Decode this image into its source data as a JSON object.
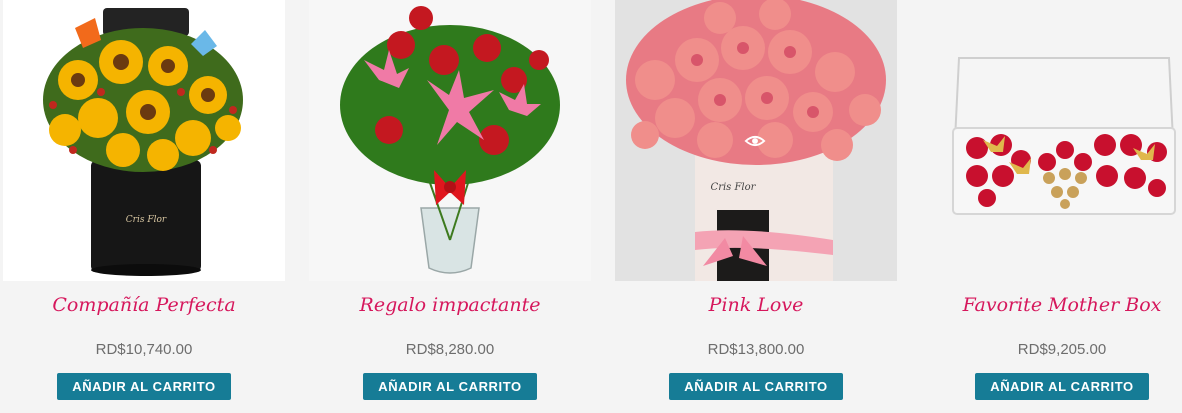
{
  "products": [
    {
      "image_alt": "sunflowers-yellow-roses-black-box",
      "title": "Compañía Perfecta",
      "price": "RD$10,740.00",
      "button_label": "AÑADIR AL CARRITO"
    },
    {
      "image_alt": "red-roses-pink-lilies-glass-vase",
      "title": "Regalo impactante",
      "price": "RD$8,280.00",
      "button_label": "AÑADIR AL CARRITO"
    },
    {
      "image_alt": "pink-roses-white-box-ribbon",
      "title": "Pink Love",
      "price": "RD$13,800.00",
      "button_label": "AÑADIR AL CARRITO"
    },
    {
      "image_alt": "red-roses-chocolates-clear-box-butterflies",
      "title": "Favorite Mother Box",
      "price": "RD$9,205.00",
      "button_label": "AÑADIR AL CARRITO"
    }
  ],
  "quick_view_icon": "eye-icon",
  "colors": {
    "title": "#d6175c",
    "price": "#6d6d6d",
    "button_bg": "#167c96",
    "page_bg": "#f4f4f4"
  }
}
